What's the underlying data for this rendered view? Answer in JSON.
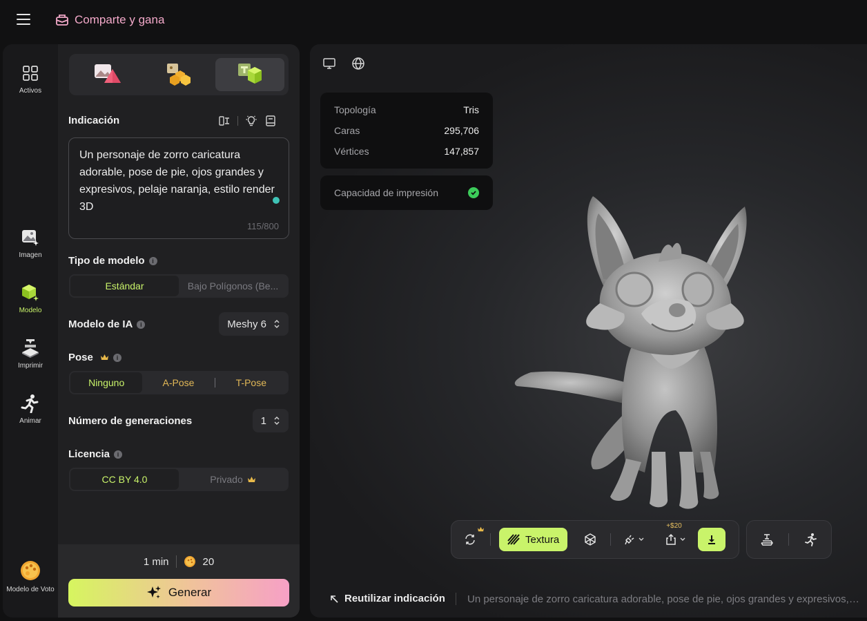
{
  "header": {
    "share_label": "Comparte y gana"
  },
  "rail": {
    "assets": "Activos",
    "image": "Imagen",
    "model": "Modelo",
    "print": "Imprimir",
    "animate": "Animar",
    "vote": "Modelo de Voto"
  },
  "prompt": {
    "label": "Indicación",
    "text": "Un personaje de zorro caricatura adorable, pose de pie, ojos grandes y expresivos, pelaje naranja, estilo render 3D",
    "count": "115/800"
  },
  "model_type": {
    "label": "Tipo de modelo",
    "options": [
      "Estándar",
      "Bajo Polígonos (Be..."
    ],
    "selected": "Estándar"
  },
  "ai_model": {
    "label": "Modelo de IA",
    "value": "Meshy 6"
  },
  "pose": {
    "label": "Pose",
    "options": [
      "Ninguno",
      "A-Pose",
      "T-Pose"
    ],
    "selected": "Ninguno"
  },
  "generations": {
    "label": "Número de generaciones",
    "value": "1"
  },
  "license": {
    "label": "Licencia",
    "options": [
      "CC BY 4.0",
      "Privado"
    ],
    "selected": "CC BY 4.0"
  },
  "footer": {
    "time": "1 min",
    "credits": "20",
    "generate_label": "Generar"
  },
  "stats": {
    "rows": [
      {
        "key": "Topología",
        "value": "Tris"
      },
      {
        "key": "Caras",
        "value": "295,706"
      },
      {
        "key": "Vértices",
        "value": "147,857"
      }
    ],
    "print_capacity": "Capacidad de impresión"
  },
  "toolbar": {
    "texture_label": "Textura",
    "export_price": "+$20"
  },
  "reuse": {
    "label": "Reutilizar indicación",
    "text": "Un personaje de zorro caricatura adorable, pose de pie, ojos grandes y expresivos, p..."
  },
  "colors": {
    "accent": "#c9f36a",
    "gold": "#e2b857",
    "pink": "#f3a9c9"
  }
}
